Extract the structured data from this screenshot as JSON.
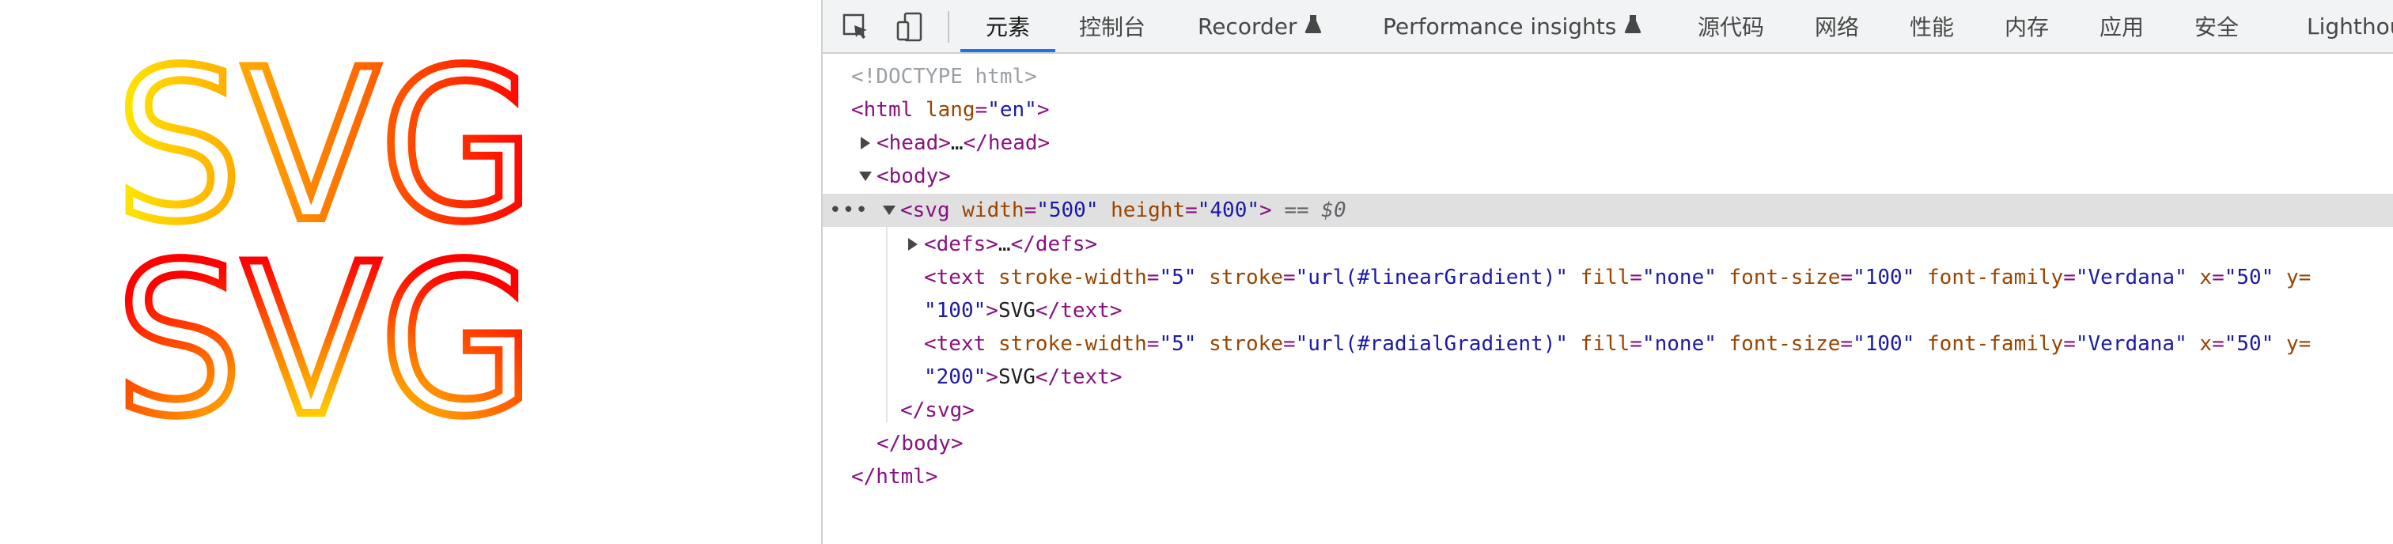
{
  "rendered_page": {
    "text_line1": "SVG",
    "text_line2": "SVG"
  },
  "devtools": {
    "tabs": [
      {
        "label": "元素",
        "active": true
      },
      {
        "label": "控制台",
        "active": false
      },
      {
        "label": "Recorder",
        "active": false,
        "experimental": true
      },
      {
        "label": "Performance insights",
        "active": false,
        "experimental": true
      },
      {
        "label": "源代码",
        "active": false
      },
      {
        "label": "网络",
        "active": false
      },
      {
        "label": "性能",
        "active": false
      },
      {
        "label": "内存",
        "active": false
      },
      {
        "label": "应用",
        "active": false
      },
      {
        "label": "安全",
        "active": false
      },
      {
        "label": "Lighthouse",
        "active": false
      }
    ],
    "icons": {
      "inspect": "select-element-icon",
      "device": "device-toolbar-icon",
      "experimental": "flask-icon"
    },
    "dom": {
      "doctype": "<!DOCTYPE html>",
      "html_open": {
        "lt": "<",
        "tag": "html",
        "attr": "lang",
        "eq": "=",
        "val": "\"en\"",
        "gt": ">"
      },
      "head": {
        "open": "<head>",
        "ellipsis": "…",
        "close": "</head>"
      },
      "body_open": "<body>",
      "svg": {
        "lt": "<",
        "tag": "svg",
        "attr1": "width",
        "val1": "\"500\"",
        "attr2": "height",
        "val2": "\"400\"",
        "gt": ">",
        "marker": "== $0",
        "dots": "•••"
      },
      "defs": {
        "open": "<defs>",
        "ellipsis": "…",
        "close": "</defs>"
      },
      "text1": {
        "lt": "<",
        "tag": "text",
        "a1": "stroke-width",
        "v1": "\"5\"",
        "a2": "stroke",
        "v2": "\"url(#linearGradient)\"",
        "a3": "fill",
        "v3": "\"none\"",
        "a4": "font-size",
        "v4": "\"100\"",
        "a5": "font-family",
        "v5": "\"Verdana\"",
        "a6": "x",
        "v6": "\"50\"",
        "a7": "y=",
        "wrap_val": "\"100\"",
        "gt": ">",
        "content": "SVG",
        "close": "</text>"
      },
      "text2": {
        "lt": "<",
        "tag": "text",
        "a1": "stroke-width",
        "v1": "\"5\"",
        "a2": "stroke",
        "v2": "\"url(#radialGradient)\"",
        "a3": "fill",
        "v3": "\"none\"",
        "a4": "font-size",
        "v4": "\"100\"",
        "a5": "font-family",
        "v5": "\"Verdana\"",
        "a6": "x",
        "v6": "\"50\"",
        "a7": "y=",
        "wrap_val": "\"200\"",
        "gt": ">",
        "content": "SVG",
        "close": "</text>"
      },
      "svg_close": "</svg>",
      "body_close": "</body>",
      "html_close": "</html>"
    }
  },
  "colors": {
    "gradient_yellow": "#ffe800",
    "gradient_orange": "#ff8a00",
    "gradient_red": "#ff0000",
    "accent_blue": "#1a73e8",
    "tag_purple": "#881280",
    "attr_brown": "#994500",
    "value_blue": "#1a1aa6"
  }
}
